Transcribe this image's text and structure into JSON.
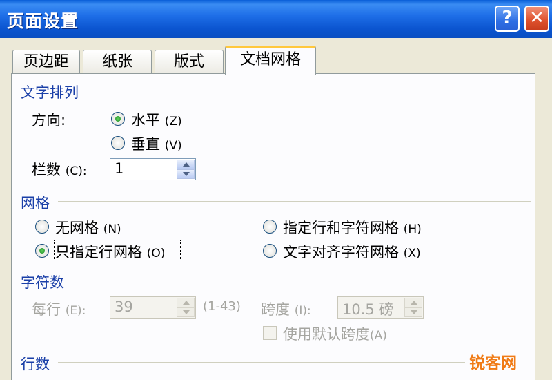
{
  "window": {
    "title": "页面设置",
    "help_label": "?",
    "close_label": "✕"
  },
  "tabs": [
    {
      "label": "页边距",
      "active": false
    },
    {
      "label": "纸张",
      "active": false
    },
    {
      "label": "版式",
      "active": false
    },
    {
      "label": "文档网格",
      "active": true
    }
  ],
  "text_direction": {
    "section": "文字排列",
    "direction_label": "方向:",
    "options": [
      {
        "label": "水平",
        "accel": "(Z)",
        "selected": true
      },
      {
        "label": "垂直",
        "accel": "(V)",
        "selected": false
      }
    ],
    "columns_label": "栏数",
    "columns_accel": "(C):",
    "columns_value": "1"
  },
  "grid": {
    "section": "网格",
    "options": [
      {
        "label": "无网格",
        "accel": "(N)",
        "selected": false
      },
      {
        "label": "只指定行网格",
        "accel": "(O)",
        "selected": true
      },
      {
        "label": "指定行和字符网格",
        "accel": "(H)",
        "selected": false
      },
      {
        "label": "文字对齐字符网格",
        "accel": "(X)",
        "selected": false
      }
    ]
  },
  "chars": {
    "section": "字符数",
    "per_line_label": "每行",
    "per_line_accel": "(E):",
    "per_line_value": "39",
    "per_line_range": "(1-43)",
    "pitch_label": "跨度",
    "pitch_accel": "(I):",
    "pitch_value": "10.5 磅",
    "default_pitch_label": "使用默认跨度",
    "default_pitch_accel": "(A)"
  },
  "lines": {
    "section": "行数"
  },
  "watermark": "锐客网",
  "colors": {
    "titlebar": "#0b55d0",
    "section_text": "#1a3fa8",
    "dialog_bg": "#ece9d8",
    "active_tab_accent": "#ffc83c"
  }
}
